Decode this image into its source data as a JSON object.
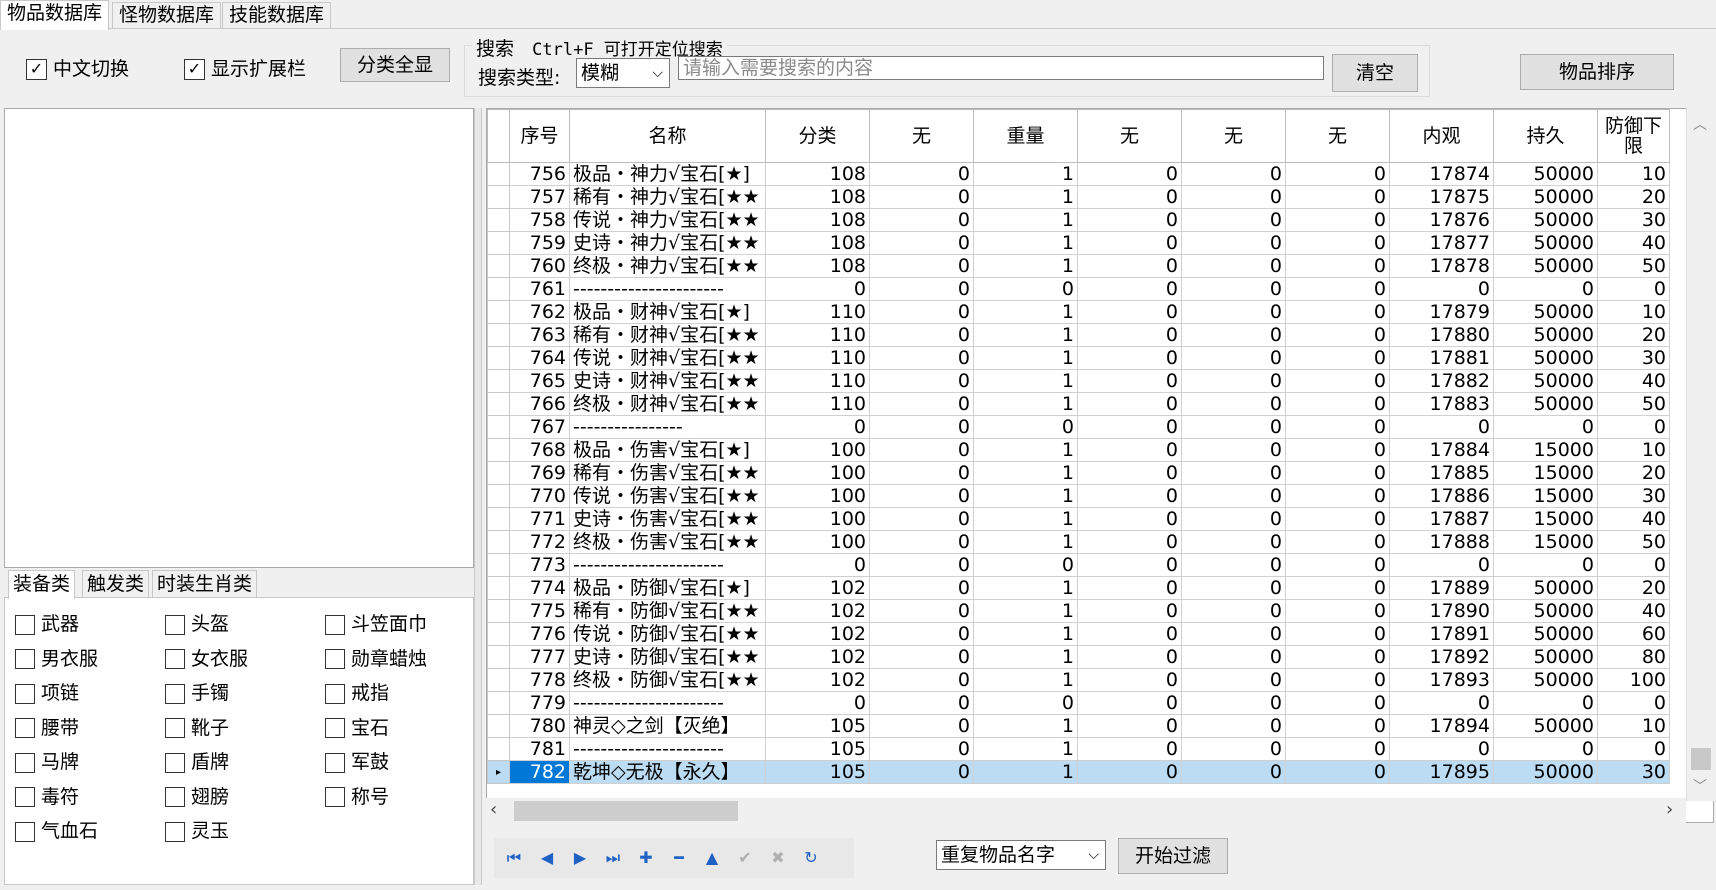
{
  "tabs": [
    "物品数据库",
    "怪物数据库",
    "技能数据库"
  ],
  "toolbar": {
    "chinese_toggle": "中文切换",
    "show_ext": "显示扩展栏",
    "show_all_categories": "分类全显",
    "search_title": "搜索",
    "search_hint": "Ctrl+F 可打开定位搜索",
    "search_type_label": "搜索类型:",
    "search_type_value": "模糊",
    "search_placeholder": "请输入需要搜索的内容",
    "clear_button": "清空",
    "sort_button": "物品排序"
  },
  "category_tabs": [
    "装备类",
    "触发类",
    "时装生肖类"
  ],
  "categories": [
    "武器",
    "头盔",
    "斗笠面巾",
    "男衣服",
    "女衣服",
    "勋章蜡烛",
    "项链",
    "手镯",
    "戒指",
    "腰带",
    "靴子",
    "宝石",
    "马牌",
    "盾牌",
    "军鼓",
    "毒符",
    "翅膀",
    "称号",
    "气血石",
    "灵玉"
  ],
  "grid": {
    "headers": [
      "序号",
      "名称",
      "分类",
      "无",
      "重量",
      "无",
      "无",
      "无",
      "内观",
      "持久",
      "防御下限"
    ],
    "rows": [
      [
        "756",
        "极品・神力√宝石[★]",
        "108",
        "0",
        "1",
        "0",
        "0",
        "0",
        "17874",
        "50000",
        "10"
      ],
      [
        "757",
        "稀有・神力√宝石[★★",
        "108",
        "0",
        "1",
        "0",
        "0",
        "0",
        "17875",
        "50000",
        "20"
      ],
      [
        "758",
        "传说・神力√宝石[★★",
        "108",
        "0",
        "1",
        "0",
        "0",
        "0",
        "17876",
        "50000",
        "30"
      ],
      [
        "759",
        "史诗・神力√宝石[★★",
        "108",
        "0",
        "1",
        "0",
        "0",
        "0",
        "17877",
        "50000",
        "40"
      ],
      [
        "760",
        "终极・神力√宝石[★★",
        "108",
        "0",
        "1",
        "0",
        "0",
        "0",
        "17878",
        "50000",
        "50"
      ],
      [
        "761",
        "----------------------",
        "0",
        "0",
        "0",
        "0",
        "0",
        "0",
        "0",
        "0",
        "0"
      ],
      [
        "762",
        "极品・财神√宝石[★]",
        "110",
        "0",
        "1",
        "0",
        "0",
        "0",
        "17879",
        "50000",
        "10"
      ],
      [
        "763",
        "稀有・财神√宝石[★★",
        "110",
        "0",
        "1",
        "0",
        "0",
        "0",
        "17880",
        "50000",
        "20"
      ],
      [
        "764",
        "传说・财神√宝石[★★",
        "110",
        "0",
        "1",
        "0",
        "0",
        "0",
        "17881",
        "50000",
        "30"
      ],
      [
        "765",
        "史诗・财神√宝石[★★",
        "110",
        "0",
        "1",
        "0",
        "0",
        "0",
        "17882",
        "50000",
        "40"
      ],
      [
        "766",
        "终极・财神√宝石[★★",
        "110",
        "0",
        "1",
        "0",
        "0",
        "0",
        "17883",
        "50000",
        "50"
      ],
      [
        "767",
        "----------------",
        "0",
        "0",
        "0",
        "0",
        "0",
        "0",
        "0",
        "0",
        "0"
      ],
      [
        "768",
        "极品・伤害√宝石[★]",
        "100",
        "0",
        "1",
        "0",
        "0",
        "0",
        "17884",
        "15000",
        "10"
      ],
      [
        "769",
        "稀有・伤害√宝石[★★",
        "100",
        "0",
        "1",
        "0",
        "0",
        "0",
        "17885",
        "15000",
        "20"
      ],
      [
        "770",
        "传说・伤害√宝石[★★",
        "100",
        "0",
        "1",
        "0",
        "0",
        "0",
        "17886",
        "15000",
        "30"
      ],
      [
        "771",
        "史诗・伤害√宝石[★★",
        "100",
        "0",
        "1",
        "0",
        "0",
        "0",
        "17887",
        "15000",
        "40"
      ],
      [
        "772",
        "终极・伤害√宝石[★★",
        "100",
        "0",
        "1",
        "0",
        "0",
        "0",
        "17888",
        "15000",
        "50"
      ],
      [
        "773",
        "----------------------",
        "0",
        "0",
        "0",
        "0",
        "0",
        "0",
        "0",
        "0",
        "0"
      ],
      [
        "774",
        "极品・防御√宝石[★]",
        "102",
        "0",
        "1",
        "0",
        "0",
        "0",
        "17889",
        "50000",
        "20"
      ],
      [
        "775",
        "稀有・防御√宝石[★★",
        "102",
        "0",
        "1",
        "0",
        "0",
        "0",
        "17890",
        "50000",
        "40"
      ],
      [
        "776",
        "传说・防御√宝石[★★",
        "102",
        "0",
        "1",
        "0",
        "0",
        "0",
        "17891",
        "50000",
        "60"
      ],
      [
        "777",
        "史诗・防御√宝石[★★",
        "102",
        "0",
        "1",
        "0",
        "0",
        "0",
        "17892",
        "50000",
        "80"
      ],
      [
        "778",
        "终极・防御√宝石[★★",
        "102",
        "0",
        "1",
        "0",
        "0",
        "0",
        "17893",
        "50000",
        "100"
      ],
      [
        "779",
        "----------------------",
        "0",
        "0",
        "0",
        "0",
        "0",
        "0",
        "0",
        "0",
        "0"
      ],
      [
        "780",
        "神灵◇之剑【灭绝】",
        "105",
        "0",
        "1",
        "0",
        "0",
        "0",
        "17894",
        "50000",
        "10"
      ],
      [
        "781",
        "----------------------",
        "105",
        "0",
        "1",
        "0",
        "0",
        "0",
        "0",
        "0",
        "0"
      ],
      [
        "782",
        "乾坤◇无极【永久】",
        "105",
        "0",
        "1",
        "0",
        "0",
        "0",
        "17895",
        "50000",
        "30"
      ]
    ],
    "selected_index": "782"
  },
  "bottom": {
    "filter_select": "重复物品名字",
    "filter_button": "开始过滤"
  },
  "nav_icons": [
    "first-icon",
    "prev-icon",
    "next-icon",
    "last-icon",
    "add-icon",
    "delete-icon",
    "up-icon",
    "confirm-icon",
    "cancel-icon",
    "refresh-icon"
  ]
}
